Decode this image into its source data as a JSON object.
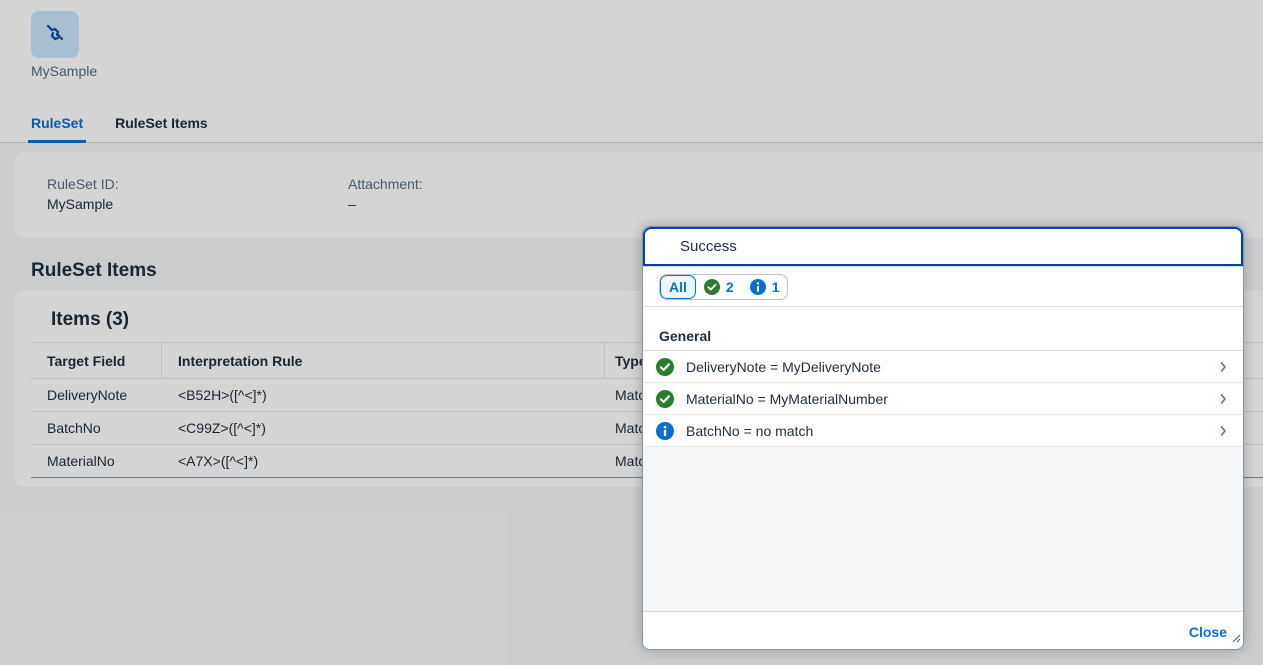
{
  "header": {
    "app_title": "MySample",
    "tabs": [
      {
        "label": "RuleSet",
        "active": true
      },
      {
        "label": "RuleSet Items",
        "active": false
      }
    ]
  },
  "ruleset_info": {
    "id_label": "RuleSet ID:",
    "id_value": "MySample",
    "attachment_label": "Attachment:",
    "attachment_value": "–"
  },
  "items_section": {
    "title": "RuleSet Items",
    "table_title": "Items (3)",
    "columns": [
      "Target Field",
      "Interpretation Rule",
      "Type"
    ],
    "rows": [
      {
        "target": "DeliveryNote",
        "rule": "<B52H>([^<]*)",
        "type": "Matc"
      },
      {
        "target": "BatchNo",
        "rule": "<C99Z>([^<]*)",
        "type": "Matc"
      },
      {
        "target": "MaterialNo",
        "rule": "<A7X>([^<]*)",
        "type": "Matc"
      }
    ]
  },
  "popover": {
    "title": "Success",
    "filters": {
      "all_label": "All",
      "success_count": "2",
      "info_count": "1"
    },
    "group_title": "General",
    "messages": [
      {
        "text": "DeliveryNote = MyDeliveryNote",
        "type": "success"
      },
      {
        "text": "MaterialNo = MyMaterialNumber",
        "type": "success"
      },
      {
        "text": "BatchNo = no match",
        "type": "information"
      }
    ],
    "close_label": "Close"
  },
  "colors": {
    "brand": "#0a6ed1",
    "success": "#2b7d2b",
    "information": "#0a6ed1",
    "app_icon_bg": "#c8e6fc"
  },
  "icons": {
    "app": "chain-link-icon",
    "success": "check-circle-icon",
    "information": "info-circle-icon",
    "navigation": "chevron-right-icon",
    "resize": "resize-handle-icon"
  }
}
